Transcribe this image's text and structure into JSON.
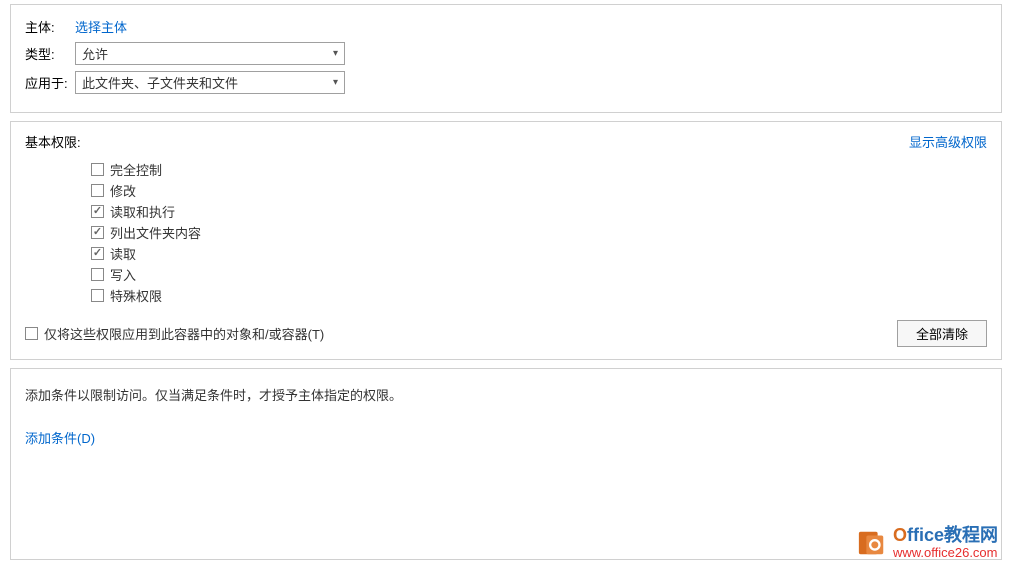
{
  "form": {
    "principal_label": "主体:",
    "principal_link": "选择主体",
    "type_label": "类型:",
    "type_value": "允许",
    "apply_label": "应用于:",
    "apply_value": "此文件夹、子文件夹和文件"
  },
  "permissions": {
    "title": "基本权限:",
    "advanced_link": "显示高级权限",
    "items": [
      {
        "label": "完全控制",
        "checked": false
      },
      {
        "label": "修改",
        "checked": false
      },
      {
        "label": "读取和执行",
        "checked": true
      },
      {
        "label": "列出文件夹内容",
        "checked": true
      },
      {
        "label": "读取",
        "checked": true
      },
      {
        "label": "写入",
        "checked": false
      },
      {
        "label": "特殊权限",
        "checked": false
      }
    ],
    "apply_only_label": "仅将这些权限应用到此容器中的对象和/或容器(T)",
    "clear_all_btn": "全部清除"
  },
  "conditions": {
    "description": "添加条件以限制访问。仅当满足条件时，才授予主体指定的权限。",
    "add_link": "添加条件(D)"
  },
  "watermark": {
    "line1_first": "O",
    "line1_rest": "ffice教程网",
    "line2": "www.office26.com"
  }
}
